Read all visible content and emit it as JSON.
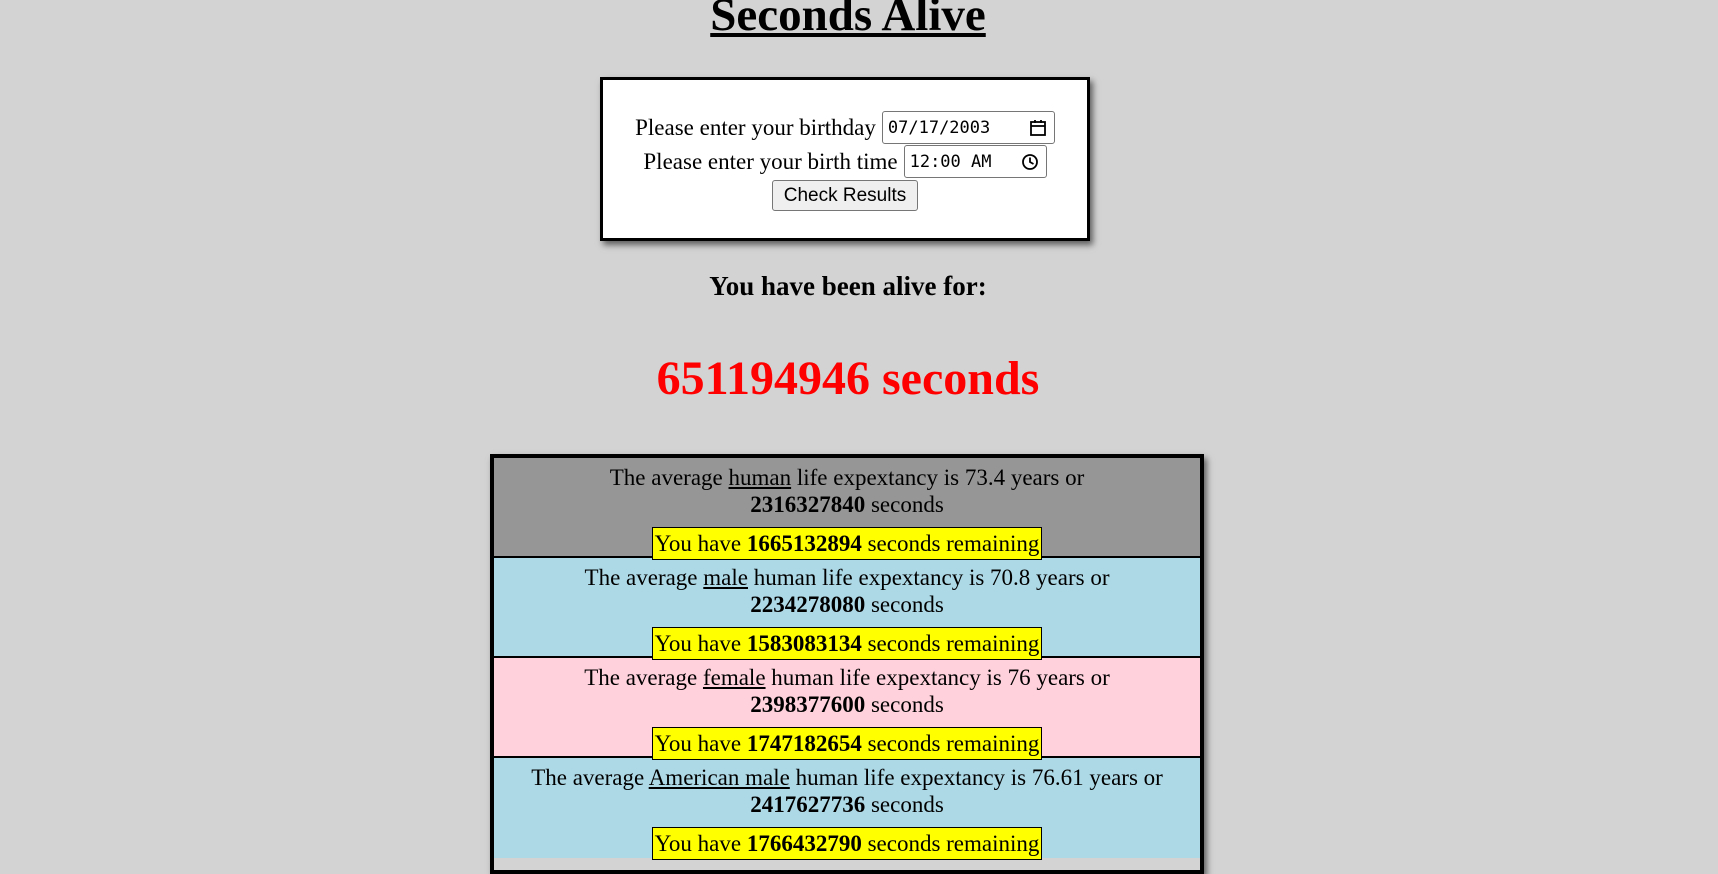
{
  "title": "Seconds Alive",
  "form": {
    "birthday_label": "Please enter your birthday",
    "birthday_value": "07/17/2003",
    "birthtime_label": "Please enter your birth time",
    "birthtime_value": "12:00 AM",
    "button_label": "Check Results",
    "icons": [
      "calendar-icon",
      "clock-icon"
    ]
  },
  "alive": {
    "heading": "You have been alive for:",
    "count_text": "651194946 seconds"
  },
  "results": [
    {
      "prefix": "The average",
      "subject": "human",
      "suffix": "life expextancy is 73.4 years or",
      "seconds": "2316327840",
      "seconds_unit": "seconds",
      "remaining_prefix": "You have",
      "remaining": "1665132894",
      "remaining_suffix": "seconds remaining",
      "color": "#969696"
    },
    {
      "prefix": "The average",
      "subject": "male",
      "suffix": "human life expextancy is 70.8 years or",
      "seconds": "2234278080",
      "seconds_unit": "seconds",
      "remaining_prefix": "You have",
      "remaining": "1583083134",
      "remaining_suffix": "seconds remaining",
      "color": "#add8e6"
    },
    {
      "prefix": "The average",
      "subject": "female",
      "suffix": "human life expextancy is 76 years or",
      "seconds": "2398377600",
      "seconds_unit": "seconds",
      "remaining_prefix": "You have",
      "remaining": "1747182654",
      "remaining_suffix": "seconds remaining",
      "color": "#ffd1dc"
    },
    {
      "prefix": "The average",
      "subject": "American male",
      "suffix": "human life expextancy is 76.61 years or",
      "seconds": "2417627736",
      "seconds_unit": "seconds",
      "remaining_prefix": "You have",
      "remaining": "1766432790",
      "remaining_suffix": "seconds remaining",
      "color": "#add8e6"
    }
  ]
}
